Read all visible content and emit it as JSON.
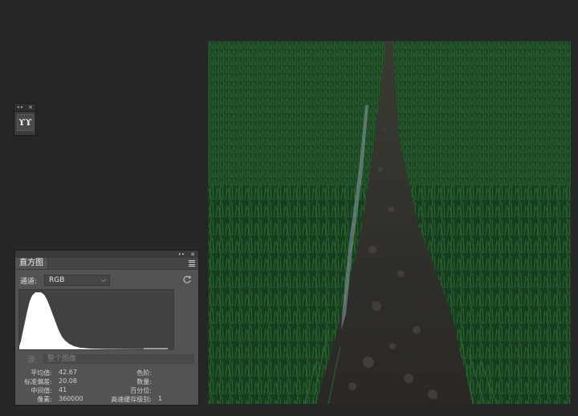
{
  "tool_panel": {
    "tool_icon": "rice-field-tool-icon",
    "glyph": "ϒϒ"
  },
  "histogram_panel": {
    "tab_label": "直方图",
    "channel_label": "通道:",
    "channel_value": "RGB",
    "source_label": "源:",
    "source_value": "整个图像",
    "stats": {
      "mean_label": "平均值:",
      "mean_value": "42.67",
      "stddev_label": "标准偏差:",
      "stddev_value": "20.08",
      "median_label": "中间值:",
      "median_value": "41",
      "pixels_label": "像素:",
      "pixels_value": "360000",
      "level_label": "色阶:",
      "level_value": "",
      "count_label": "数量:",
      "count_value": "",
      "percentile_label": "百分位:",
      "percentile_value": "",
      "cache_label": "高速缓存级别:",
      "cache_value": "1"
    }
  },
  "canvas": {
    "image": "rice-paddy-field-with-irrigation-ditch"
  },
  "colors": {
    "background": "#262626",
    "panel": "#535353",
    "histogram_fill": "#ffffff"
  }
}
